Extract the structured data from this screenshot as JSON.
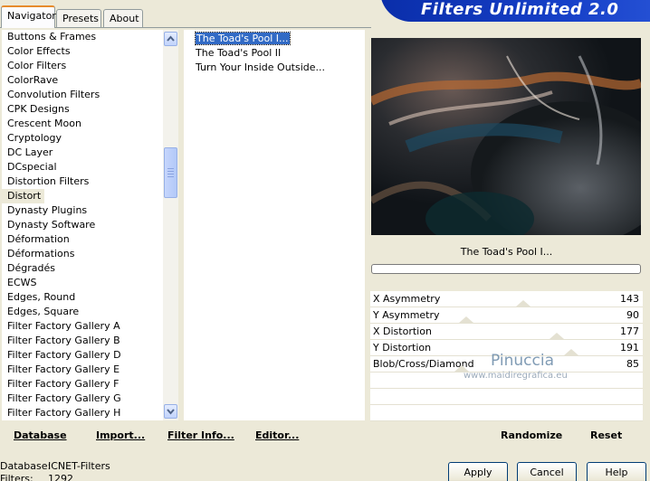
{
  "tabs": [
    {
      "label": "Navigator",
      "active": true
    },
    {
      "label": "Presets",
      "active": false
    },
    {
      "label": "About",
      "active": false
    }
  ],
  "banner": {
    "title": "Filters Unlimited 2.0"
  },
  "categories": [
    "Buttons & Frames",
    "Color Effects",
    "Color Filters",
    "ColorRave",
    "Convolution Filters",
    "CPK Designs",
    "Crescent Moon",
    "Cryptology",
    "DC Layer",
    "DCspecial",
    "Distortion Filters",
    "Distort",
    "Dynasty Plugins",
    "Dynasty Software",
    "Déformation",
    "Déformations",
    "Dégradés",
    "ECWS",
    "Edges, Round",
    "Edges, Square",
    "Filter Factory Gallery A",
    "Filter Factory Gallery B",
    "Filter Factory Gallery D",
    "Filter Factory Gallery E",
    "Filter Factory Gallery F",
    "Filter Factory Gallery G",
    "Filter Factory Gallery H"
  ],
  "selected_category": "Distort",
  "filters": [
    "The Toad's Pool I...",
    "The Toad's Pool II",
    "Turn Your Inside Outside..."
  ],
  "selected_filter": "The Toad's Pool I...",
  "current_filter_name": "The Toad's Pool I...",
  "params": [
    {
      "label": "X Asymmetry",
      "value": "143"
    },
    {
      "label": "Y Asymmetry",
      "value": "90"
    },
    {
      "label": "X Distortion",
      "value": "177"
    },
    {
      "label": "Y Distortion",
      "value": "191"
    },
    {
      "label": "Blob/Cross/Diamond",
      "value": "85"
    }
  ],
  "watermark": {
    "name": "Pinuccia",
    "url": "www.maidiregrafica.eu"
  },
  "toolbar": {
    "database": "Database",
    "import": "Import...",
    "filter_info": "Filter Info...",
    "editor": "Editor...",
    "randomize": "Randomize",
    "reset": "Reset"
  },
  "status": {
    "database_label": "Database:",
    "database_value": "ICNET-Filters",
    "filters_label": "Filters:",
    "filters_value": "1292"
  },
  "buttons": {
    "apply": "Apply",
    "cancel": "Cancel",
    "help": "Help"
  },
  "colors": {
    "selection": "#316ac5",
    "banner": "#1640c8",
    "dialog_bg": "#ece9d8"
  }
}
